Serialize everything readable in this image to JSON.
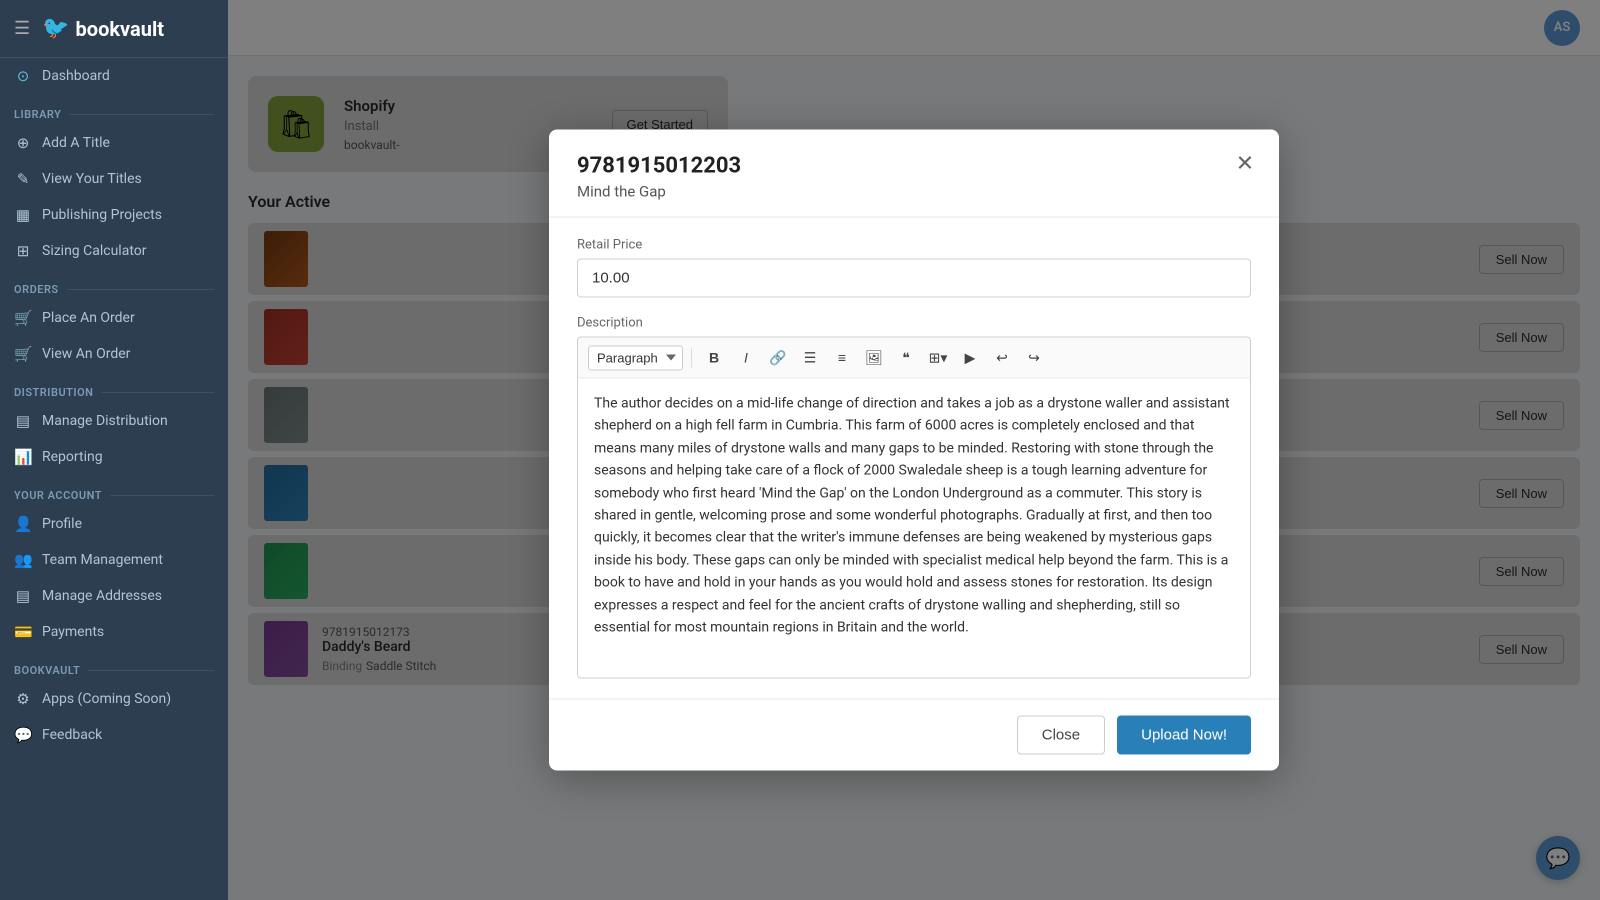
{
  "brand": {
    "name": "bookvault",
    "bird_symbol": "🐦"
  },
  "sidebar": {
    "dashboard_label": "Dashboard",
    "library_label": "Library",
    "library_items": [
      {
        "id": "add-title",
        "label": "Add A Title",
        "icon": "+"
      },
      {
        "id": "view-titles",
        "label": "View Your Titles",
        "icon": "▤"
      },
      {
        "id": "publishing-projects",
        "label": "Publishing Projects",
        "icon": "▦"
      },
      {
        "id": "sizing-calculator",
        "label": "Sizing Calculator",
        "icon": "⊞"
      }
    ],
    "orders_label": "Orders",
    "orders_items": [
      {
        "id": "place-order",
        "label": "Place An Order",
        "icon": "🛒"
      },
      {
        "id": "view-order",
        "label": "View An Order",
        "icon": "🛒"
      }
    ],
    "distribution_label": "Distribution",
    "distribution_items": [
      {
        "id": "manage-distribution",
        "label": "Manage Distribution",
        "icon": "▤"
      },
      {
        "id": "reporting",
        "label": "Reporting",
        "icon": "📊"
      }
    ],
    "account_label": "Your Account",
    "account_items": [
      {
        "id": "profile",
        "label": "Profile",
        "icon": "👤"
      },
      {
        "id": "team-management",
        "label": "Team Management",
        "icon": "👥"
      },
      {
        "id": "manage-addresses",
        "label": "Manage Addresses",
        "icon": "▤"
      },
      {
        "id": "payments",
        "label": "Payments",
        "icon": "💳"
      }
    ],
    "bookvault_label": "Bookvault",
    "bookvault_items": [
      {
        "id": "apps",
        "label": "Apps (Coming Soon)",
        "icon": "⚙"
      },
      {
        "id": "feedback",
        "label": "Feedback",
        "icon": "💬"
      }
    ]
  },
  "topbar": {
    "avatar_initials": "AS"
  },
  "main": {
    "shopify": {
      "title": "Shopify",
      "get_started_label": "Get Started"
    },
    "active_titles_header": "Your Active",
    "install_text": "Install",
    "install_name": "bookvault-",
    "books": [
      {
        "id": "b1",
        "thumb_class": "t1",
        "isbn": "",
        "title": "",
        "sell_label": "Sell Now"
      },
      {
        "id": "b2",
        "thumb_class": "t2",
        "isbn": "",
        "title": "",
        "sell_label": "Sell Now"
      },
      {
        "id": "b3",
        "thumb_class": "t3",
        "isbn": "",
        "title": "",
        "sell_label": "Sell Now"
      },
      {
        "id": "b4",
        "thumb_class": "t4",
        "isbn": "",
        "title": "",
        "sell_label": "Sell Now"
      },
      {
        "id": "b5",
        "thumb_class": "t5",
        "isbn": "",
        "title": "",
        "sell_label": "Sell Now"
      },
      {
        "id": "b6",
        "thumb_class": "t6",
        "isbn": "9781915012173",
        "title": "Daddy's Beard",
        "binding_label": "Binding",
        "binding_value": "Saddle Stitch",
        "sell_label": "Sell Now"
      }
    ]
  },
  "modal": {
    "isbn": "9781915012203",
    "subtitle": "Mind the Gap",
    "close_icon": "✕",
    "retail_price_label": "Retail Price",
    "retail_price_value": "10.00",
    "description_label": "Description",
    "toolbar": {
      "paragraph_option": "Paragraph",
      "bold": "B",
      "italic": "I",
      "link": "🔗",
      "bullet_list": "☰",
      "ordered_list": "☰",
      "image": "🖼",
      "quote": "❝",
      "table": "⊞",
      "video": "▶",
      "undo": "↩",
      "redo": "↪"
    },
    "description_text": "The author decides on a mid-life change of direction and takes a job as a drystone waller and assistant shepherd on a high fell farm in Cumbria. This farm of 6000 acres is completely enclosed and that means many miles of drystone walls and many gaps to be minded. Restoring with stone through the seasons and helping take care of a flock of 2000 Swaledale sheep is a tough learning adventure for somebody who first heard 'Mind the Gap' on the London Underground as a commuter. This story is shared in gentle, welcoming prose and some wonderful photographs. Gradually at first, and then too quickly, it becomes clear that the writer's immune defenses are being weakened by mysterious gaps inside his body. These gaps can only be minded with specialist medical help beyond the farm. This is a book to have and hold in your hands as you would hold and assess stones for restoration. Its design expresses a respect and feel for the ancient crafts of drystone walling and shepherding, still so essential for most mountain regions in Britain and the world.",
    "close_btn_label": "Close",
    "upload_btn_label": "Upload Now!"
  },
  "chat": {
    "icon": "💬"
  }
}
